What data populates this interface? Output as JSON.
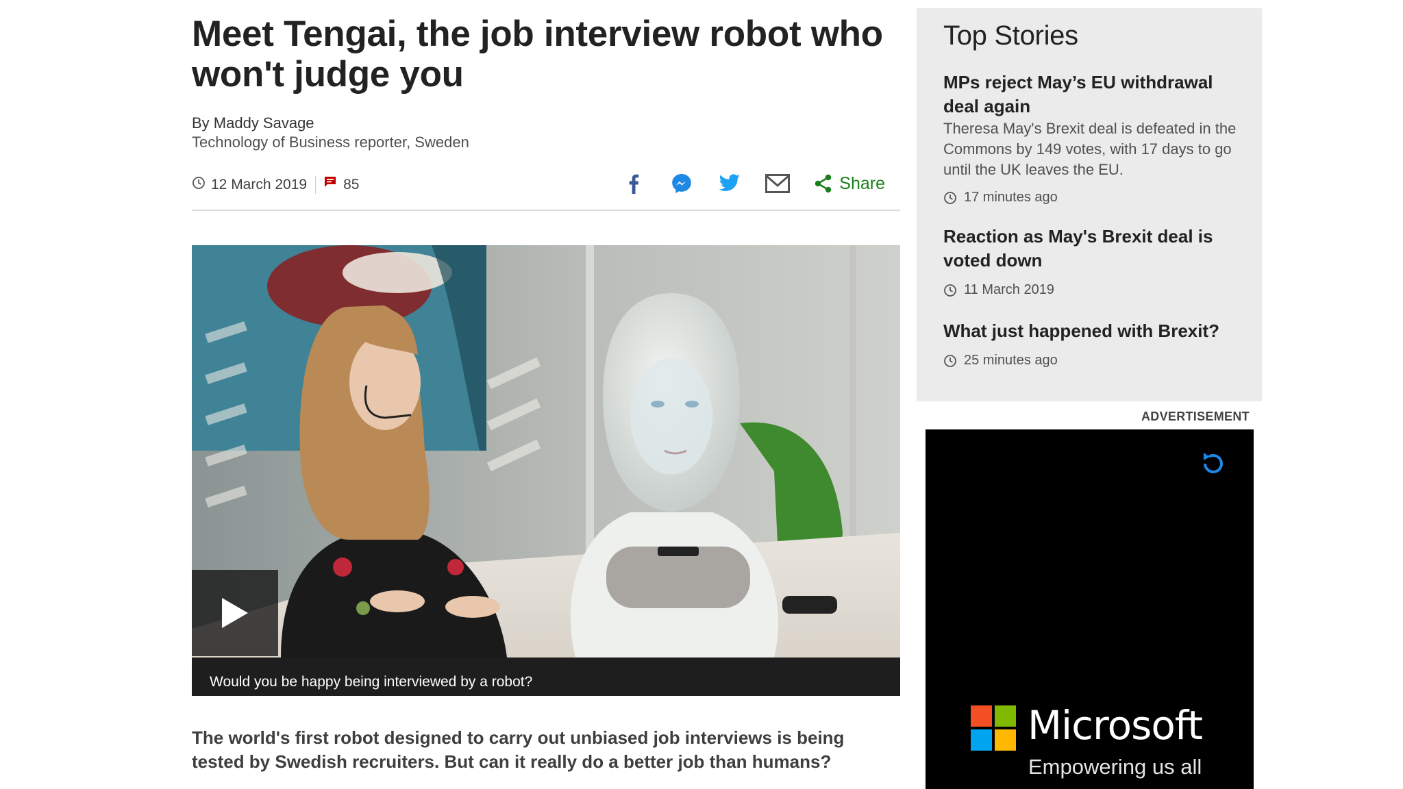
{
  "article": {
    "title": "Meet Tengai, the job interview robot who won't judge you",
    "author": "By Maddy Savage",
    "author_role": "Technology of Business reporter, Sweden",
    "date": "12 March 2019",
    "comment_count": "85",
    "share_label": "Share",
    "share_icons": [
      "facebook-icon",
      "messenger-icon",
      "twitter-icon",
      "email-icon"
    ],
    "video_caption": "Would you be happy being interviewed by a robot?",
    "lede": "The world's first robot designed to carry out unbiased job interviews is being tested by Swedish recruiters. But can it really do a better job than humans?"
  },
  "sidebar": {
    "heading": "Top Stories",
    "stories": [
      {
        "headline": "MPs reject May’s EU withdrawal deal again",
        "summary": "Theresa May's Brexit deal is defeated in the Commons by 149 votes, with 17 days to go until the UK leaves the EU.",
        "time": "17 minutes ago"
      },
      {
        "headline": "Reaction as May's Brexit deal is voted down",
        "time": "11 March 2019"
      },
      {
        "headline": "What just happened with Brexit?",
        "time": "25 minutes ago"
      }
    ]
  },
  "advert": {
    "label": "ADVERTISEMENT",
    "brand": "Microsoft",
    "tagline": "Empowering us all",
    "logo_colors": [
      "#f25022",
      "#7fba00",
      "#00a4ef",
      "#ffb900"
    ]
  },
  "colors": {
    "share_green": "#1a7f1a",
    "facebook_blue": "#3b5998",
    "messenger_blue": "#1e88e5",
    "twitter_blue": "#1da1f2",
    "comment_red": "#c00000",
    "sidebar_bg": "#ebebeb"
  }
}
